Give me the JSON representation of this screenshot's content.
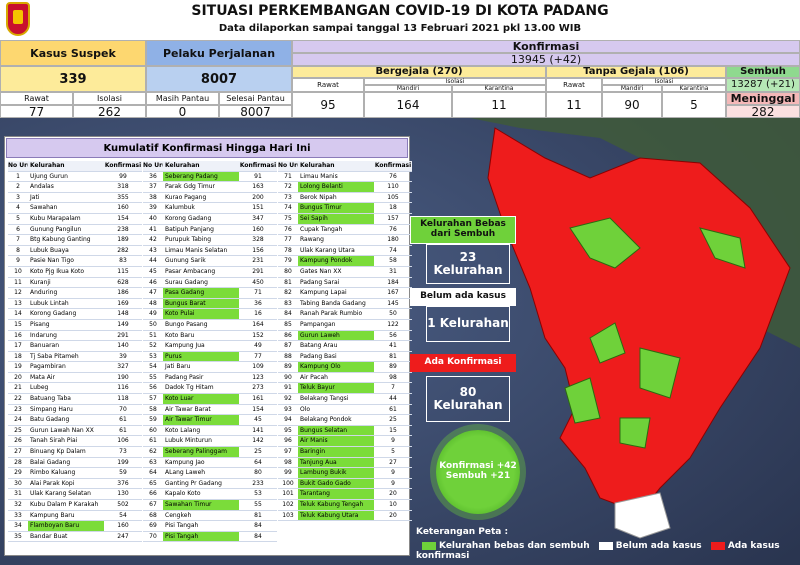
{
  "header": {
    "title": "SITUASI PERKEMBANGAN COVID-19 DI KOTA PADANG",
    "subtitle": "Data dilaporkan sampai tanggal 13 Februari 2021 pkl 13.00 WIB"
  },
  "stats": {
    "suspek": {
      "label": "Kasus Suspek",
      "value": "339",
      "rawat_label": "Rawat",
      "rawat": "77",
      "isolasi_label": "Isolasi",
      "isolasi": "262"
    },
    "perjalanan": {
      "label": "Pelaku Perjalanan",
      "value": "8007",
      "masih_label": "Masih Pantau",
      "masih": "0",
      "selesai_label": "Selesai Pantau",
      "selesai": "8007"
    },
    "konfirmasi": {
      "label": "Konfirmasi",
      "value": "13945 (+42)"
    },
    "bergejala": {
      "label": "Bergejala (270)",
      "rawat_label": "Rawat",
      "rawat": "95",
      "isolasi_label": "Isolasi",
      "mandiri_label": "Mandiri",
      "mandiri": "164",
      "karantina_label": "Karantina",
      "karantina": "11"
    },
    "tanpa": {
      "label": "Tanpa Gejala (106)",
      "rawat_label": "Rawat",
      "rawat": "11",
      "isolasi_label": "Isolasi",
      "mandiri_label": "Mandiri",
      "mandiri": "90",
      "karantina_label": "Karantina",
      "karantina": "5"
    },
    "sembuh": {
      "label": "Sembuh",
      "value": "13287 (+21)"
    },
    "meninggal": {
      "label": "Meninggal",
      "value": "282"
    }
  },
  "table": {
    "title": "Kumulatif Konfirmasi Hingga Hari Ini",
    "headers": [
      "No Urut",
      "Kelurahan",
      "Konfirmasi"
    ],
    "rows": [
      [
        1,
        "Ujung Gurun",
        99
      ],
      [
        2,
        "Andalas",
        318
      ],
      [
        3,
        "Jati",
        355
      ],
      [
        4,
        "Sawahan",
        160
      ],
      [
        5,
        "Kubu Marapalam",
        154
      ],
      [
        6,
        "Gunung Pangilun",
        238
      ],
      [
        7,
        "Btg Kabung Ganting",
        189
      ],
      [
        8,
        "Lubuk Buaya",
        282
      ],
      [
        9,
        "Pasie Nan Tigo",
        83
      ],
      [
        10,
        "Koto Pjg Ikua Koto",
        115
      ],
      [
        11,
        "Kuranji",
        628
      ],
      [
        12,
        "Anduring",
        186
      ],
      [
        13,
        "Lubuk Lintah",
        169
      ],
      [
        14,
        "Korong Gadang",
        148
      ],
      [
        15,
        "Pisang",
        149
      ],
      [
        16,
        "Indarung",
        291
      ],
      [
        17,
        "Banuaran",
        140
      ],
      [
        18,
        "Tj Saba Pitameh",
        39
      ],
      [
        19,
        "Pagambiran",
        327
      ],
      [
        20,
        "Mata Air",
        190
      ],
      [
        21,
        "Lubeg",
        116
      ],
      [
        22,
        "Batuang Taba",
        118
      ],
      [
        23,
        "Simpang Haru",
        70
      ],
      [
        24,
        "Batu Gadang",
        61
      ],
      [
        25,
        "Gurun Lawah Nan XX",
        61
      ],
      [
        26,
        "Tanah Sirah Piai",
        106
      ],
      [
        27,
        "Binuang Kp Dalam",
        73
      ],
      [
        28,
        "Balai Gadang",
        199
      ],
      [
        29,
        "Rimbo Kaluang",
        59
      ],
      [
        30,
        "Alai Parak Kopi",
        376
      ],
      [
        31,
        "Ulak Karang Selatan",
        130
      ],
      [
        32,
        "Kubu Dalam P Karakah",
        502
      ],
      [
        33,
        "Kampung Baru",
        54
      ],
      [
        34,
        "Flamboyan Baru",
        160
      ],
      [
        35,
        "Bandar Buat",
        247
      ],
      [
        36,
        "Seberang Padang",
        91
      ],
      [
        37,
        "Parak Gdg Timur",
        163
      ],
      [
        38,
        "Kurao Pagang",
        200
      ],
      [
        39,
        "Kalumbuk",
        151
      ],
      [
        40,
        "Korong Gadang",
        347
      ],
      [
        41,
        "Batipuh Panjang",
        160
      ],
      [
        42,
        "Purupuk Tabing",
        328
      ],
      [
        43,
        "Limau Manis Selatan",
        156
      ],
      [
        44,
        "Gunung Sarik",
        231
      ],
      [
        45,
        "Pasar Ambacang",
        291
      ],
      [
        46,
        "Surau Gadang",
        450
      ],
      [
        47,
        "Pasa Gadang",
        71
      ],
      [
        48,
        "Bungus Barat",
        36
      ],
      [
        49,
        "Koto Pulai",
        16
      ],
      [
        50,
        "Bungo Pasang",
        164
      ],
      [
        51,
        "Koto Baru",
        152
      ],
      [
        52,
        "Kampung Jua",
        49
      ],
      [
        53,
        "Purus",
        77
      ],
      [
        54,
        "Jati Baru",
        109
      ],
      [
        55,
        "Padang Pasir",
        123
      ],
      [
        56,
        "Dadok Tg Hitam",
        273
      ],
      [
        57,
        "Koto Luar",
        161
      ],
      [
        58,
        "Air Tawar Barat",
        154
      ],
      [
        59,
        "Air Tawar Timur",
        45
      ],
      [
        60,
        "Koto Lalang",
        141
      ],
      [
        61,
        "Lubuk Minturun",
        142
      ],
      [
        62,
        "Seberang Palinggam",
        25
      ],
      [
        63,
        "Kampung Jao",
        64
      ],
      [
        64,
        "ALang Laweh",
        80
      ],
      [
        65,
        "Ganting Pr Gadang",
        233
      ],
      [
        66,
        "Kapalo Koto",
        53
      ],
      [
        67,
        "Sawahan Timur",
        55
      ],
      [
        68,
        "Cengkeh",
        81
      ],
      [
        69,
        "Pisi Tangah",
        84
      ],
      [
        70,
        "Pisi Tangah",
        84
      ],
      [
        71,
        "Limau Manis",
        76
      ],
      [
        72,
        "Lolong Belanti",
        110
      ],
      [
        73,
        "Berok Nipah",
        105
      ],
      [
        74,
        "Bungus Timur",
        18
      ],
      [
        75,
        "Sei Sapih",
        157
      ],
      [
        76,
        "Cupak Tangah",
        76
      ],
      [
        77,
        "Rawang",
        180
      ],
      [
        78,
        "Ulak Karang Utara",
        74
      ],
      [
        79,
        "Kampung Pondok",
        58
      ],
      [
        80,
        "Gates Nan XX",
        31
      ],
      [
        81,
        "Padang Sarai",
        184
      ],
      [
        82,
        "Kampung Lapai",
        167
      ],
      [
        83,
        "Tabing Banda Gadang",
        145
      ],
      [
        84,
        "Ranah Parak Rumbio",
        50
      ],
      [
        85,
        "Pampangan",
        122
      ],
      [
        86,
        "Gurun Laweh",
        56
      ],
      [
        87,
        "Batang Arau",
        41
      ],
      [
        88,
        "Padang Basi",
        81
      ],
      [
        89,
        "Kampung Olo",
        89
      ],
      [
        90,
        "Air Pacah",
        98
      ],
      [
        91,
        "Teluk Bayur",
        7
      ],
      [
        92,
        "Belakang Tangsi",
        44
      ],
      [
        93,
        "Olo",
        61
      ],
      [
        94,
        "Belakang Pondok",
        25
      ],
      [
        95,
        "Bungus Selatan",
        15
      ],
      [
        96,
        "Air Manis",
        9
      ],
      [
        97,
        "Baringin",
        5
      ],
      [
        98,
        "Tanjung Aua",
        27
      ],
      [
        99,
        "Lambung Bukik",
        9
      ],
      [
        100,
        "Bukit Gado Gado",
        9
      ],
      [
        101,
        "Tarantang",
        20
      ],
      [
        102,
        "Teluk Kabung Tengah",
        10
      ],
      [
        103,
        "Teluk Kabung Utara",
        20
      ]
    ],
    "green": [
      36,
      47,
      48,
      49,
      53,
      57,
      59,
      62,
      67,
      70,
      72,
      74,
      75,
      79,
      86,
      89,
      91,
      95,
      96,
      97,
      98,
      99,
      100,
      101,
      102,
      103,
      34
    ]
  },
  "annotations": {
    "bebas": {
      "label": "Kelurahan Bebas dari Sembuh",
      "count": "23 Kelurahan"
    },
    "belum": {
      "label": "Belum ada kasus",
      "count": "1 Kelurahan"
    },
    "ada": {
      "label": "Ada Konfirmasi",
      "count": "80 Kelurahan"
    },
    "virus": "Konfirmasi +42 Sembuh +21"
  },
  "legend": {
    "title": "Keterangan Peta :",
    "green": "Kelurahan bebas dan sembuh",
    "white": "Belum ada kasus",
    "red": "Ada kasus konfirmasi"
  },
  "colors": {
    "green": "#6fd13a",
    "red": "#ee1c1c",
    "purple": "#d6c9ef",
    "yellow": "#fdeb9a",
    "blue": "#b9d0f0",
    "pink": "#f4b8b8"
  }
}
